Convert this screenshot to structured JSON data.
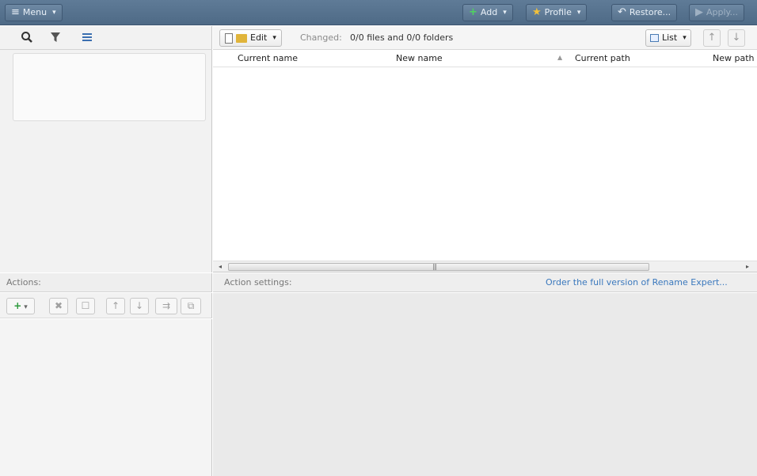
{
  "toolbar": {
    "menu": "Menu",
    "add": "Add",
    "profile": "Profile",
    "restore": "Restore...",
    "apply": "Apply..."
  },
  "left_tabs": [
    "search",
    "filter",
    "list"
  ],
  "file_toolbar": {
    "edit": "Edit",
    "changed_label": "Changed:",
    "changed_value": "0/0 files and 0/0 folders",
    "view": "List"
  },
  "file_list": {
    "columns": [
      "Current name",
      "New name",
      "Current path",
      "New path"
    ]
  },
  "actions": {
    "title": "Actions:"
  },
  "settings": {
    "title": "Action settings:",
    "order_link": "Order the full version of Rename Expert..."
  },
  "colors": {
    "titlebar": "#587490",
    "link": "#3a78bd",
    "add_green": "#2c9a3c",
    "folder": "#e0b43a"
  }
}
